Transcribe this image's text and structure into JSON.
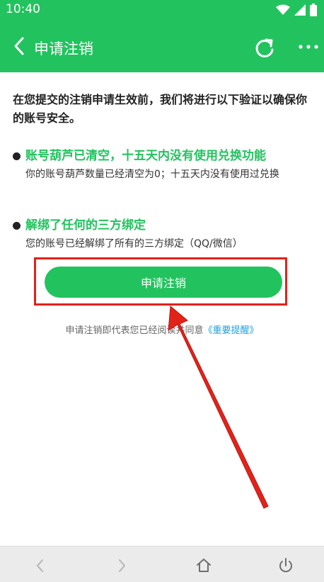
{
  "status_bar": {
    "time": "10:40"
  },
  "app_bar": {
    "title": "申请注销"
  },
  "intro_text": "在您提交的注销申请生效前，我们将进行以下验证以确保你的账号安全。",
  "checks": [
    {
      "title": "账号葫芦已清空，十五天内没有使用兑换功能",
      "desc": "你的账号葫芦数量已经清空为0；十五天内没有使用过兑换"
    },
    {
      "title": "解绑了任何的三方绑定",
      "desc": "您的账号已经解绑了所有的三方绑定（QQ/微信）"
    }
  ],
  "apply_button_label": "申请注销",
  "agreement": {
    "prefix": "申请注销即代表您已经阅读并同意",
    "link": "《重要提醒》"
  },
  "colors": {
    "brand_green": "#22c35e",
    "highlight_red": "#e2231a",
    "link_blue": "#1aa1e3"
  },
  "icons": [
    "wifi-icon",
    "signal-icon",
    "battery-icon",
    "back-arrow-icon",
    "refresh-icon",
    "more-icon",
    "nav-back-icon",
    "nav-forward-icon",
    "home-icon",
    "power-icon"
  ]
}
